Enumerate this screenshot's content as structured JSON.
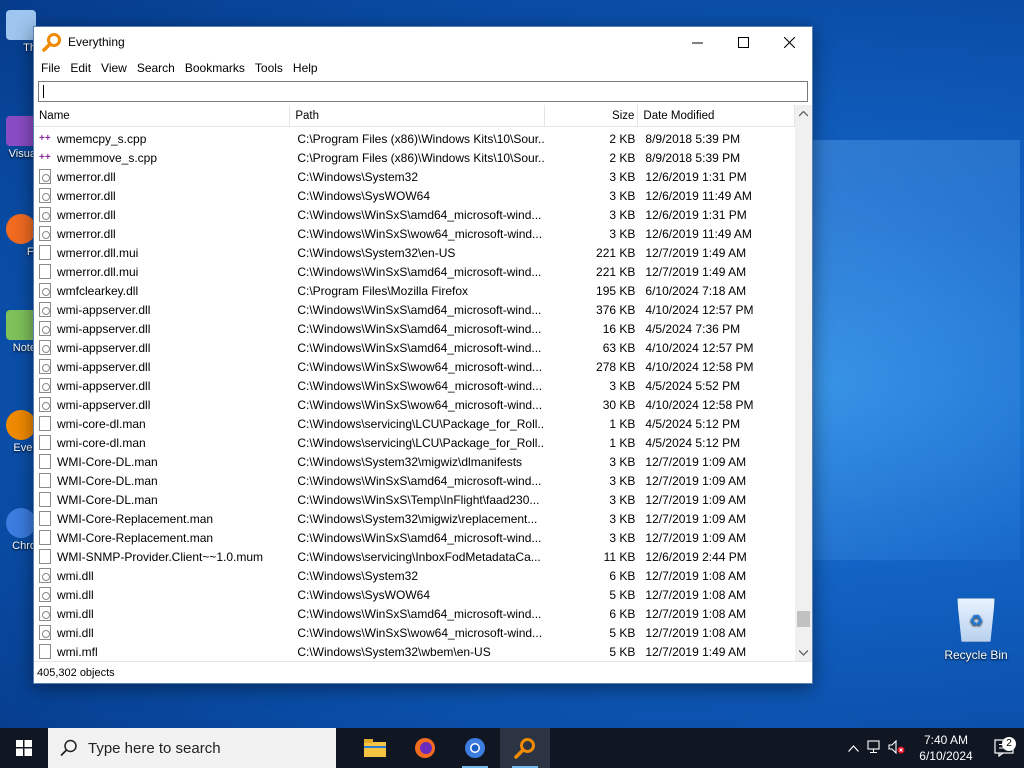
{
  "window": {
    "title": "Everything",
    "menu": [
      "File",
      "Edit",
      "View",
      "Search",
      "Bookmarks",
      "Tools",
      "Help"
    ],
    "search_value": "",
    "columns": {
      "name": "Name",
      "path": "Path",
      "size": "Size",
      "date": "Date Modified"
    },
    "status": "405,302 objects"
  },
  "rows": [
    {
      "icon": "cpp",
      "name": "wmemcpy_s.cpp",
      "path": "C:\\Program Files (x86)\\Windows Kits\\10\\Sour...",
      "size": "2 KB",
      "date": "8/9/2018 5:39 PM"
    },
    {
      "icon": "cpp",
      "name": "wmemmove_s.cpp",
      "path": "C:\\Program Files (x86)\\Windows Kits\\10\\Sour...",
      "size": "2 KB",
      "date": "8/9/2018 5:39 PM"
    },
    {
      "icon": "dll",
      "name": "wmerror.dll",
      "path": "C:\\Windows\\System32",
      "size": "3 KB",
      "date": "12/6/2019 1:31 PM"
    },
    {
      "icon": "dll",
      "name": "wmerror.dll",
      "path": "C:\\Windows\\SysWOW64",
      "size": "3 KB",
      "date": "12/6/2019 11:49 AM"
    },
    {
      "icon": "dll",
      "name": "wmerror.dll",
      "path": "C:\\Windows\\WinSxS\\amd64_microsoft-wind...",
      "size": "3 KB",
      "date": "12/6/2019 1:31 PM"
    },
    {
      "icon": "dll",
      "name": "wmerror.dll",
      "path": "C:\\Windows\\WinSxS\\wow64_microsoft-wind...",
      "size": "3 KB",
      "date": "12/6/2019 11:49 AM"
    },
    {
      "icon": "file",
      "name": "wmerror.dll.mui",
      "path": "C:\\Windows\\System32\\en-US",
      "size": "221 KB",
      "date": "12/7/2019 1:49 AM"
    },
    {
      "icon": "file",
      "name": "wmerror.dll.mui",
      "path": "C:\\Windows\\WinSxS\\amd64_microsoft-wind...",
      "size": "221 KB",
      "date": "12/7/2019 1:49 AM"
    },
    {
      "icon": "dll",
      "name": "wmfclearkey.dll",
      "path": "C:\\Program Files\\Mozilla Firefox",
      "size": "195 KB",
      "date": "6/10/2024 7:18 AM"
    },
    {
      "icon": "dll",
      "name": "wmi-appserver.dll",
      "path": "C:\\Windows\\WinSxS\\amd64_microsoft-wind...",
      "size": "376 KB",
      "date": "4/10/2024 12:57 PM"
    },
    {
      "icon": "dll",
      "name": "wmi-appserver.dll",
      "path": "C:\\Windows\\WinSxS\\amd64_microsoft-wind...",
      "size": "16 KB",
      "date": "4/5/2024 7:36 PM"
    },
    {
      "icon": "dll",
      "name": "wmi-appserver.dll",
      "path": "C:\\Windows\\WinSxS\\amd64_microsoft-wind...",
      "size": "63 KB",
      "date": "4/10/2024 12:57 PM"
    },
    {
      "icon": "dll",
      "name": "wmi-appserver.dll",
      "path": "C:\\Windows\\WinSxS\\wow64_microsoft-wind...",
      "size": "278 KB",
      "date": "4/10/2024 12:58 PM"
    },
    {
      "icon": "dll",
      "name": "wmi-appserver.dll",
      "path": "C:\\Windows\\WinSxS\\wow64_microsoft-wind...",
      "size": "3 KB",
      "date": "4/5/2024 5:52 PM"
    },
    {
      "icon": "dll",
      "name": "wmi-appserver.dll",
      "path": "C:\\Windows\\WinSxS\\wow64_microsoft-wind...",
      "size": "30 KB",
      "date": "4/10/2024 12:58 PM"
    },
    {
      "icon": "file",
      "name": "wmi-core-dl.man",
      "path": "C:\\Windows\\servicing\\LCU\\Package_for_Roll...",
      "size": "1 KB",
      "date": "4/5/2024 5:12 PM"
    },
    {
      "icon": "file",
      "name": "wmi-core-dl.man",
      "path": "C:\\Windows\\servicing\\LCU\\Package_for_Roll...",
      "size": "1 KB",
      "date": "4/5/2024 5:12 PM"
    },
    {
      "icon": "file",
      "name": "WMI-Core-DL.man",
      "path": "C:\\Windows\\System32\\migwiz\\dlmanifests",
      "size": "3 KB",
      "date": "12/7/2019 1:09 AM"
    },
    {
      "icon": "file",
      "name": "WMI-Core-DL.man",
      "path": "C:\\Windows\\WinSxS\\amd64_microsoft-wind...",
      "size": "3 KB",
      "date": "12/7/2019 1:09 AM"
    },
    {
      "icon": "file",
      "name": "WMI-Core-DL.man",
      "path": "C:\\Windows\\WinSxS\\Temp\\InFlight\\faad230...",
      "size": "3 KB",
      "date": "12/7/2019 1:09 AM"
    },
    {
      "icon": "file",
      "name": "WMI-Core-Replacement.man",
      "path": "C:\\Windows\\System32\\migwiz\\replacement...",
      "size": "3 KB",
      "date": "12/7/2019 1:09 AM"
    },
    {
      "icon": "file",
      "name": "WMI-Core-Replacement.man",
      "path": "C:\\Windows\\WinSxS\\amd64_microsoft-wind...",
      "size": "3 KB",
      "date": "12/7/2019 1:09 AM"
    },
    {
      "icon": "file",
      "name": "WMI-SNMP-Provider.Client~~1.0.mum",
      "path": "C:\\Windows\\servicing\\InboxFodMetadataCa...",
      "size": "11 KB",
      "date": "12/6/2019 2:44 PM"
    },
    {
      "icon": "dll",
      "name": "wmi.dll",
      "path": "C:\\Windows\\System32",
      "size": "6 KB",
      "date": "12/7/2019 1:08 AM"
    },
    {
      "icon": "dll",
      "name": "wmi.dll",
      "path": "C:\\Windows\\SysWOW64",
      "size": "5 KB",
      "date": "12/7/2019 1:08 AM"
    },
    {
      "icon": "dll",
      "name": "wmi.dll",
      "path": "C:\\Windows\\WinSxS\\amd64_microsoft-wind...",
      "size": "6 KB",
      "date": "12/7/2019 1:08 AM"
    },
    {
      "icon": "dll",
      "name": "wmi.dll",
      "path": "C:\\Windows\\WinSxS\\wow64_microsoft-wind...",
      "size": "5 KB",
      "date": "12/7/2019 1:08 AM"
    },
    {
      "icon": "file",
      "name": "wmi.mfl",
      "path": "C:\\Windows\\System32\\wbem\\en-US",
      "size": "5 KB",
      "date": "12/7/2019 1:49 AM"
    }
  ],
  "desktop": {
    "icons": [
      "Th",
      "Visua",
      "Fi",
      "Note",
      "Ever",
      "Chro"
    ],
    "recycle_bin": "Recycle Bin"
  },
  "taskbar": {
    "search_placeholder": "Type here to search",
    "time": "7:40 AM",
    "date": "6/10/2024",
    "notification_count": "2"
  },
  "colors": {
    "accent": "#0078d7",
    "everything_icon": "#f08a00",
    "taskbar_bg": "#101622"
  }
}
